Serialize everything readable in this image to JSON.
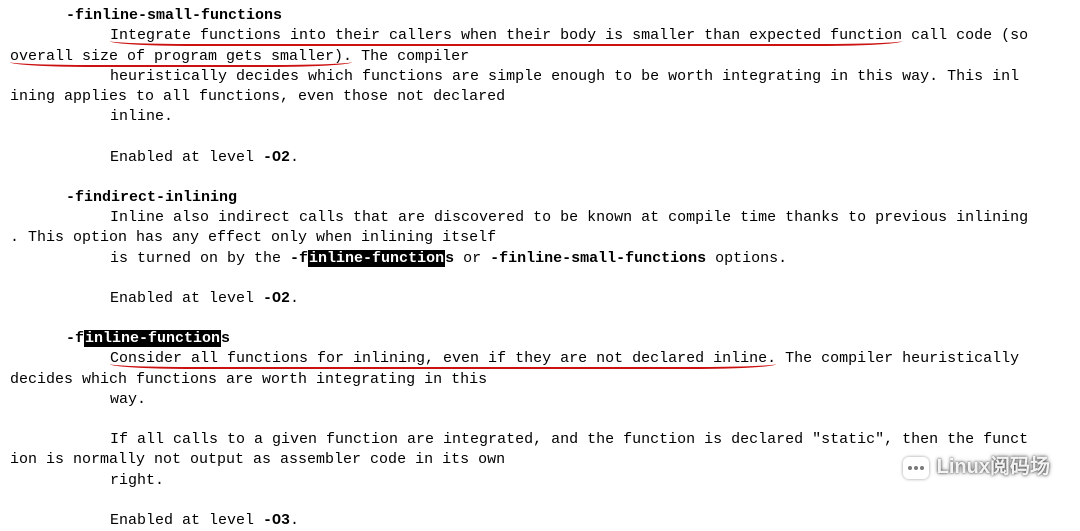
{
  "sections": {
    "finline_small": {
      "name": "-finline-small-functions",
      "line1a": "Integrate functions into their callers when their body is smaller than expected function",
      "line1b": " call code (so",
      "line2": " overall size of program gets smaller).",
      "line2b": "  The compiler",
      "line3": "heuristically decides which functions are simple enough to be worth integrating in this way.  This inl",
      "line4": "ining applies to all functions, even those not declared",
      "line5": "inline.",
      "enabled_prefix": "Enabled at level ",
      "enabled_level": "-O2",
      "enabled_suffix": "."
    },
    "findirect": {
      "name": "-findirect-inlining",
      "line1": "Inline also indirect calls that are discovered to be known at compile time thanks to previous inlining",
      "line2": ".  This option has any effect only when inlining itself",
      "line3a": "is turned on by the ",
      "line3b": "-f",
      "line3c": "inline-function",
      "line3d": "s",
      "line3e": " or ",
      "line3f": "-finline-small-functions",
      "line3g": " options.",
      "enabled_prefix": "Enabled at level ",
      "enabled_level": "-O2",
      "enabled_suffix": "."
    },
    "finline_funcs": {
      "name_a": "-f",
      "name_b": "inline-function",
      "name_c": "s",
      "line1a": "Consider all functions for inlining, even if they are not declared inline.",
      "line1b": "  The compiler heuristically",
      "line2": " decides which functions are worth integrating in this",
      "line3": "way.",
      "line4": "If all calls to a given function are integrated, and the function is declared \"static\", then the funct",
      "line5": "ion is normally not output as assembler code in its own",
      "line6": "right.",
      "enabled_prefix": "Enabled at level ",
      "enabled_level": "-O3",
      "enabled_suffix": "."
    }
  },
  "watermark": "Linux阅码场"
}
